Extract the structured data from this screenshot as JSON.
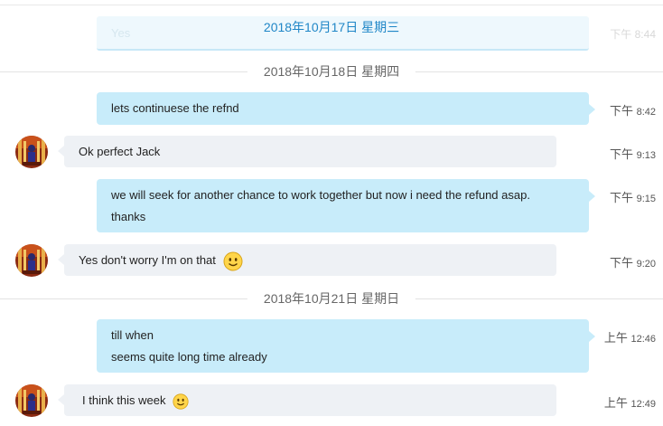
{
  "header": {
    "sticky_date": "2018年10月17日 星期三",
    "ghost_text": "Yes",
    "ghost_time": "下午 8:44"
  },
  "dates": {
    "d1": "2018年10月18日 星期四",
    "d2": "2018年10月21日 星期日"
  },
  "messages": [
    {
      "side": "out",
      "lines": [
        "lets continuese the refnd"
      ],
      "time_prefix": "下午",
      "time": "8:42"
    },
    {
      "side": "in",
      "lines": [
        "Ok perfect Jack"
      ],
      "time_prefix": "下午",
      "time": "9:13"
    },
    {
      "side": "out",
      "lines": [
        "we will seek for another chance to work together but now i need the refund asap.",
        "thanks"
      ],
      "time_prefix": "下午",
      "time": "9:15"
    },
    {
      "side": "in",
      "lines": [
        "Yes don't worry I'm on that"
      ],
      "emoji": "smiley-icon",
      "time_prefix": "下午",
      "time": "9:20"
    },
    {
      "side": "out",
      "lines": [
        "till when",
        "seems quite long time already"
      ],
      "time_prefix": "上午",
      "time": "12:46"
    },
    {
      "side": "in",
      "lines": [
        "I think this week"
      ],
      "emoji": "smiley-icon",
      "time_prefix": "上午",
      "time": "12:49"
    }
  ],
  "colors": {
    "outgoing_bubble": "#c8ecfa",
    "incoming_bubble": "#eef1f5",
    "sticky_date": "#1f86c7"
  }
}
